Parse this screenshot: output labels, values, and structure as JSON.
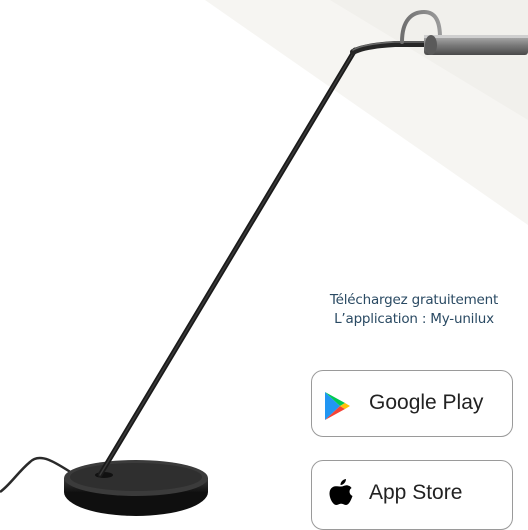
{
  "promo": {
    "line1": "Téléchargez gratuitement",
    "line2": "L’application : My-unilux"
  },
  "stores": {
    "google_play": {
      "label": "Google Play",
      "icon": "google-play-icon"
    },
    "app_store": {
      "label": "App Store",
      "icon": "apple-icon"
    }
  },
  "colors": {
    "text_blue": "#2a4a63",
    "badge_border": "#9a9a9a",
    "lamp_body": "#1c1c1c",
    "lamp_head": "#8a8a8a",
    "background": "#ffffff"
  }
}
